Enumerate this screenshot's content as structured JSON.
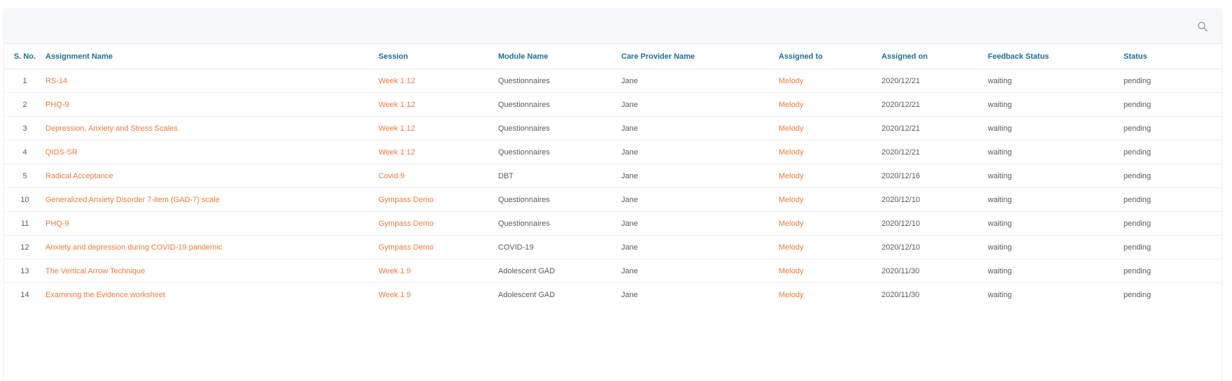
{
  "search": {
    "icon": "search-icon"
  },
  "table": {
    "headers": {
      "sno": "S. No.",
      "assignment": "Assignment Name",
      "session": "Session",
      "module": "Module Name",
      "care_provider": "Care Provider Name",
      "assigned_to": "Assigned to",
      "assigned_on": "Assigned on",
      "feedback": "Feedback Status",
      "status": "Status"
    },
    "rows": [
      {
        "sno": "1",
        "assignment": "RS-14",
        "session": "Week 1 12",
        "module": "Questionnaires",
        "care_provider": "Jane",
        "assigned_to": "Melody",
        "assigned_on": "2020/12/21",
        "feedback": "waiting",
        "status": "pending"
      },
      {
        "sno": "2",
        "assignment": "PHQ-9",
        "session": "Week 1 12",
        "module": "Questionnaires",
        "care_provider": "Jane",
        "assigned_to": "Melody",
        "assigned_on": "2020/12/21",
        "feedback": "waiting",
        "status": "pending"
      },
      {
        "sno": "3",
        "assignment": "Depression, Anxiety and Stress Scales",
        "session": "Week 1 12",
        "module": "Questionnaires",
        "care_provider": "Jane",
        "assigned_to": "Melody",
        "assigned_on": "2020/12/21",
        "feedback": "waiting",
        "status": "pending"
      },
      {
        "sno": "4",
        "assignment": "QIDS-SR",
        "session": "Week 1 12",
        "module": "Questionnaires",
        "care_provider": "Jane",
        "assigned_to": "Melody",
        "assigned_on": "2020/12/21",
        "feedback": "waiting",
        "status": "pending"
      },
      {
        "sno": "5",
        "assignment": "Radical Acceptance",
        "session": "Covid 9",
        "module": "DBT",
        "care_provider": "Jane",
        "assigned_to": "Melody",
        "assigned_on": "2020/12/16",
        "feedback": "waiting",
        "status": "pending"
      },
      {
        "sno": "10",
        "assignment": "Generalized Anxiety Disorder 7-item (GAD-7) scale",
        "session": "Gympass Demo",
        "module": "Questionnaires",
        "care_provider": "Jane",
        "assigned_to": "Melody",
        "assigned_on": "2020/12/10",
        "feedback": "waiting",
        "status": "pending"
      },
      {
        "sno": "11",
        "assignment": "PHQ-9",
        "session": "Gympass Demo",
        "module": "Questionnaires",
        "care_provider": "Jane",
        "assigned_to": "Melody",
        "assigned_on": "2020/12/10",
        "feedback": "waiting",
        "status": "pending"
      },
      {
        "sno": "12",
        "assignment": "Anxiety and depression during COVID-19 pandemic",
        "session": "Gympass Demo",
        "module": "COVID-19",
        "care_provider": "Jane",
        "assigned_to": "Melody",
        "assigned_on": "2020/12/10",
        "feedback": "waiting",
        "status": "pending"
      },
      {
        "sno": "13",
        "assignment": "The Vertical Arrow Technique",
        "session": "Week 1 9",
        "module": "Adolescent GAD",
        "care_provider": "Jane",
        "assigned_to": "Melody",
        "assigned_on": "2020/11/30",
        "feedback": "waiting",
        "status": "pending"
      },
      {
        "sno": "14",
        "assignment": "Examining the Evidence worksheet",
        "session": "Week 1 9",
        "module": "Adolescent GAD",
        "care_provider": "Jane",
        "assigned_to": "Melody",
        "assigned_on": "2020/11/30",
        "feedback": "waiting",
        "status": "pending"
      }
    ]
  },
  "colors": {
    "header_text": "#1f6f97",
    "link": "#ef7a3a",
    "body_text": "#555d63",
    "toolbar_bg": "#f7f8f9"
  }
}
